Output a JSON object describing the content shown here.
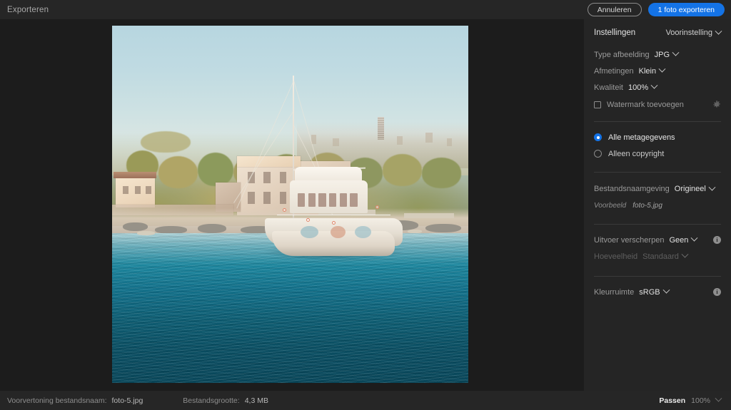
{
  "topbar": {
    "title": "Exporteren",
    "cancel_label": "Annuleren",
    "export_label": "1 foto exporteren",
    "accent_color": "#1473e6"
  },
  "panel": {
    "title": "Instellingen",
    "preset_label": "Voorinstelling",
    "rows": [
      {
        "label": "Type afbeelding",
        "value": "JPG"
      },
      {
        "label": "Afmetingen",
        "value": "Klein"
      },
      {
        "label": "Kwaliteit",
        "value": "100%"
      }
    ],
    "watermark": {
      "label": "Watermark toevoegen",
      "checked": false,
      "settings_icon": "gear-icon"
    },
    "metadata": {
      "options": [
        {
          "label": "Alle metagegevens",
          "selected": true
        },
        {
          "label": "Alleen copyright",
          "selected": false
        }
      ]
    },
    "naming": {
      "label": "Bestandsnaamgeving",
      "value": "Origineel",
      "preview_label": "Voorbeeld",
      "preview_value": "foto-5.jpg"
    },
    "sharpening": {
      "label": "Uitvoer verscherpen",
      "value": "Geen",
      "amount_label": "Hoeveelheid",
      "amount_value": "Standaard",
      "amount_disabled": true,
      "info_icon": "info-icon"
    },
    "colorspace": {
      "label": "Kleurruimte",
      "value": "sRGB",
      "info_icon": "info-icon"
    }
  },
  "bottombar": {
    "filename_label": "Voorvertoning bestandsnaam:",
    "filename_value": "foto-5.jpg",
    "filesize_label": "Bestandsgrootte:",
    "filesize_value": "4,3 MB",
    "zoom_fit": "Passen",
    "zoom_percent": "100%"
  },
  "preview_image": {
    "alt": "Luchtfoto van een witte catamaran op turkoois water voor een kustlijn met kalkstenen gebouwen"
  }
}
